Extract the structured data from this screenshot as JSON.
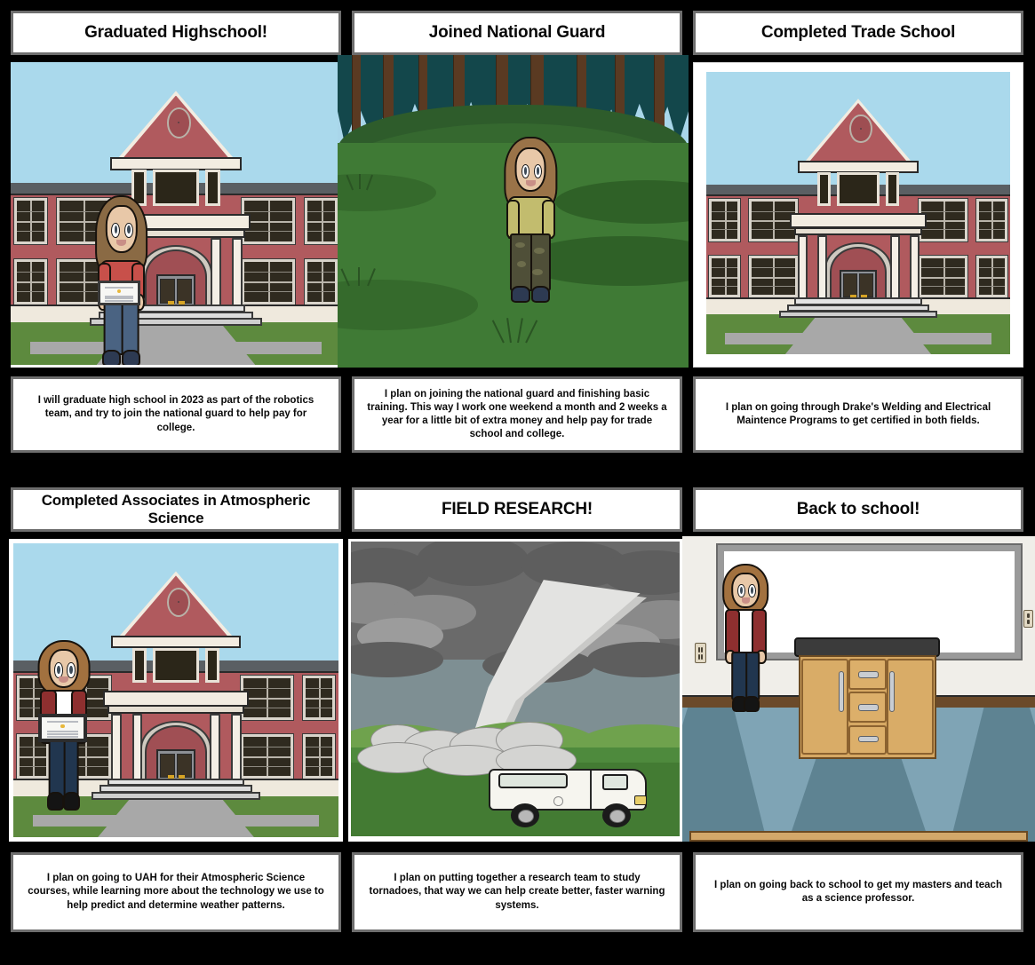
{
  "storyboard": {
    "columns": 3,
    "rows": 2,
    "background_color": "#000000",
    "cell_border_color": "#6e6e6e",
    "cell_background": "#ffffff",
    "panels": [
      {
        "id": "panel-1",
        "title": "Graduated Highschool!",
        "caption": "I will graduate high school in 2023 as part of the robotics team, and try to join the national guard to help pay for college.",
        "scene": "school-exterior-with-graduate",
        "scene_elements": [
          "sky",
          "brick-school-building",
          "pediment",
          "columns",
          "arched-entry",
          "double-doors",
          "steps",
          "lawn",
          "walkway",
          "girl-character",
          "diploma"
        ],
        "colors": {
          "sky": "#aad9ec",
          "brick": "#b05a5e",
          "trim": "#f2ece1",
          "lawn": "#5d8a3e",
          "walkway": "#a8a8a8",
          "shirt": "#c8504a",
          "jeans": "#4a6382",
          "hair": "#8a6a44"
        }
      },
      {
        "id": "panel-2",
        "title": "Joined National Guard",
        "caption": "I plan on joining the national guard and finishing basic training. This way I work one weekend a month and 2 weeks a year for a little bit of extra money and help pay for trade school and college.",
        "scene": "forest-field-with-soldier",
        "scene_elements": [
          "sky",
          "pine-tree-canopy",
          "tree-trunks",
          "grass-hills",
          "grass-tufts",
          "girl-character"
        ],
        "colors": {
          "sky": "#a9d6ea",
          "canopy": "#13474b",
          "trunk": "#5a3a22",
          "grass": "#3f7a35",
          "grass-dark": "#2e5c2b",
          "shirt": "#c2bc6e",
          "camo-pants": "#4f4f38",
          "hair": "#9a7348"
        }
      },
      {
        "id": "panel-3",
        "title": "Completed Trade School",
        "caption": "I plan on going through Drake's Welding and Electrical Maintence Programs to get certified in both fields.",
        "scene": "school-exterior-empty",
        "scene_elements": [
          "sky",
          "brick-school-building",
          "pediment",
          "columns",
          "arched-entry",
          "double-doors",
          "steps",
          "lawn",
          "walkway"
        ],
        "colors": {
          "sky": "#aad9ec",
          "brick": "#b05a5e",
          "trim": "#f2ece1",
          "lawn": "#5d8a3e",
          "walkway": "#a8a8a8"
        }
      },
      {
        "id": "panel-4",
        "title": "Completed Associates in Atmospheric Science",
        "caption": "I plan on going to UAH for their Atmospheric Science courses, while learning more about the technology we use to help predict and determine weather patterns.",
        "scene": "school-exterior-with-graduate-framed-diploma",
        "scene_elements": [
          "sky",
          "brick-school-building",
          "pediment",
          "columns",
          "arched-entry",
          "double-doors",
          "steps",
          "lawn",
          "walkway",
          "woman-character",
          "framed-diploma"
        ],
        "colors": {
          "sky": "#aad9ec",
          "brick": "#b05a5e",
          "cardigan": "#8e2f2f",
          "top": "#ffffff",
          "jeans": "#21364f",
          "hair": "#a2713f"
        }
      },
      {
        "id": "panel-5",
        "title": "FIELD RESEARCH!",
        "caption": "I plan on putting together a research team to study tornadoes, that way we can help create better, faster warning systems.",
        "scene": "tornado-over-field-with-van",
        "scene_elements": [
          "storm-clouds",
          "tornado-funnel",
          "debris-cloud",
          "green-field",
          "white-van"
        ],
        "colors": {
          "sky": "#7e8f93",
          "cloud-dark": "#5e5e5e",
          "cloud-mid": "#8a8a8a",
          "cloud-light": "#9c9c9c",
          "funnel": "#e3e3e1",
          "field": "#4e8a3d",
          "van": "#f6f5ef"
        }
      },
      {
        "id": "panel-6",
        "title": "Back to school!",
        "caption": "I plan on going back to school to get my masters and teach as a science professor.",
        "scene": "classroom-with-teacher-and-lab-bench",
        "scene_elements": [
          "wall",
          "whiteboard",
          "baseboard",
          "checkered-floor",
          "lab-bench",
          "bench-drawers",
          "bench-doors",
          "electrical-outlet",
          "woman-character"
        ],
        "colors": {
          "wall": "#f0eee9",
          "whiteboard": "#ffffff",
          "floor-light": "#7fa4b5",
          "floor-dark": "#5e8392",
          "bench-wood": "#d6a863",
          "bench-top": "#3b3b3b",
          "cardigan": "#8e2f2f",
          "jeans": "#21364f"
        }
      }
    ]
  }
}
